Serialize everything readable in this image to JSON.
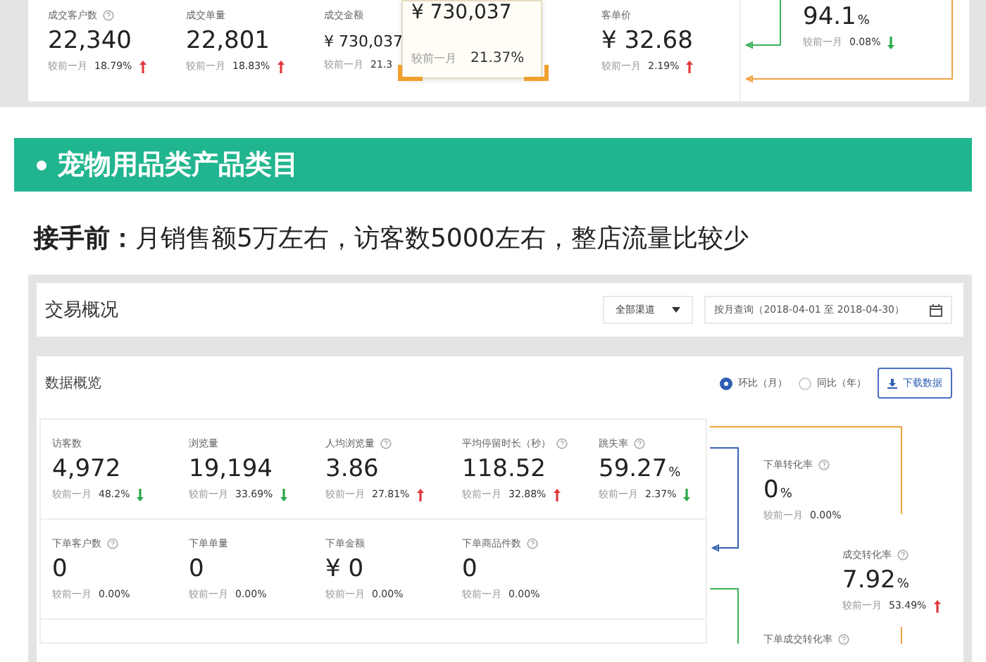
{
  "top_panel": {
    "metrics": [
      {
        "label": "成交客户数",
        "help": true,
        "value": "22,340",
        "compare_label": "较前一月",
        "change": "18.79%",
        "up": true
      },
      {
        "label": "成交单量",
        "help": false,
        "value": "22,801",
        "compare_label": "较前一月",
        "change": "18.83%",
        "up": true
      },
      {
        "label": "成交金额",
        "help": false,
        "value": "¥ 730,037",
        "compare_label": "较前一月",
        "change": "21.3"
      },
      {
        "label": "客单价",
        "help": false,
        "value": "¥ 32.68",
        "compare_label": "较前一月",
        "change": "2.19%",
        "up": true
      }
    ],
    "tooltip": {
      "value": "¥ 730,037",
      "compare_label": "较前一月",
      "change": "21.37%"
    },
    "funnel_item": {
      "value": "94.1",
      "unit": "%",
      "compare_label": "较前一月",
      "change": "0.08%",
      "up": false
    }
  },
  "banner": {
    "title": "宠物用品类产品类目"
  },
  "note": "**接手前：**月销售额5万左右，访客数5000左右，整店流量比较少",
  "panel": {
    "title": "交易概况",
    "channel_select": "全部渠道",
    "date_field": "按月查询（2018-04-01 至 2018-04-30）",
    "section_title": "数据概览",
    "radios": [
      {
        "label": "环比（月）",
        "selected": true
      },
      {
        "label": "同比（年）",
        "selected": false
      }
    ],
    "download_button": "下载数据",
    "metric_rows": [
      [
        {
          "label": "访客数",
          "help": false,
          "value": "4,972",
          "compare_label": "较前一月",
          "change": "48.2%",
          "up": false
        },
        {
          "label": "浏览量",
          "help": false,
          "value": "19,194",
          "compare_label": "较前一月",
          "change": "33.69%",
          "up": false
        },
        {
          "label": "人均浏览量",
          "help": true,
          "value": "3.86",
          "compare_label": "较前一月",
          "change": "27.81%",
          "up": true
        },
        {
          "label": "平均停留时长（秒）",
          "help": true,
          "value": "118.52",
          "compare_label": "较前一月",
          "change": "32.88%",
          "up": true
        },
        {
          "label": "跳失率",
          "help": true,
          "value": "59.27",
          "unit": "%",
          "compare_label": "较前一月",
          "change": "2.37%",
          "up": false
        }
      ],
      [
        {
          "label": "下单客户数",
          "help": true,
          "value": "0",
          "compare_label": "较前一月",
          "change": "0.00%"
        },
        {
          "label": "下单单量",
          "help": false,
          "value": "0",
          "compare_label": "较前一月",
          "change": "0.00%"
        },
        {
          "label": "下单金额",
          "help": false,
          "value": "¥ 0",
          "compare_label": "较前一月",
          "change": "0.00%"
        },
        {
          "label": "下单商品件数",
          "help": true,
          "value": "0",
          "compare_label": "较前一月",
          "change": "0.00%"
        }
      ]
    ],
    "funnel": [
      {
        "label": "下单转化率",
        "help": true,
        "value": "0",
        "unit": "%",
        "compare_label": "较前一月",
        "change": "0.00%"
      },
      {
        "label": "成交转化率",
        "help": true,
        "value": "7.92",
        "unit": "%",
        "compare_label": "较前一月",
        "change": "53.49%",
        "up": true
      },
      {
        "label": "下单成交转化率",
        "help": true
      }
    ]
  }
}
